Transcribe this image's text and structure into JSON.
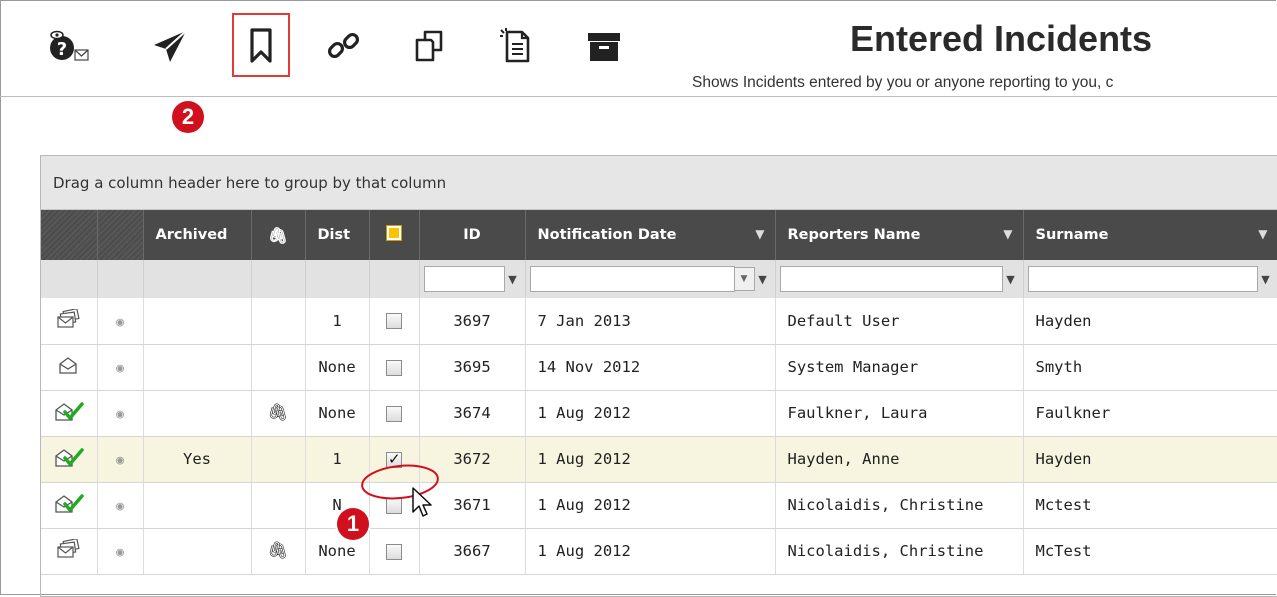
{
  "toolbar": {
    "icons": [
      "help-mail-icon",
      "send-icon",
      "bookmark-icon",
      "link-icon",
      "copy-icon",
      "new-document-icon",
      "archive-icon"
    ]
  },
  "page": {
    "title": "Entered Incidents",
    "subtitle": "Shows Incidents entered by you or anyone reporting to you, c"
  },
  "annotations": {
    "badge1": "1",
    "badge2": "2"
  },
  "grid": {
    "group_hint": "Drag a column header here to group by that column",
    "columns": [
      "",
      "",
      "Archived",
      "",
      "Dist",
      "",
      "ID",
      "Notification Date",
      "Reporters Name",
      "Surname"
    ],
    "rows": [
      {
        "status": "envelope-stack-icon",
        "archived": "",
        "attachment": false,
        "dist": "1",
        "checked": false,
        "id": "3697",
        "date": "7 Jan 2013",
        "reporter": "Default User",
        "surname": "Hayden"
      },
      {
        "status": "envelope-icon",
        "archived": "",
        "attachment": false,
        "dist": "None",
        "checked": false,
        "id": "3695",
        "date": "14 Nov 2012",
        "reporter": "System Manager",
        "surname": "Smyth"
      },
      {
        "status": "envelope-check-icon",
        "archived": "",
        "attachment": true,
        "dist": "None",
        "checked": false,
        "id": "3674",
        "date": "1 Aug 2012",
        "reporter": "Faulkner, Laura",
        "surname": "Faulkner"
      },
      {
        "status": "envelope-check-icon",
        "archived": "Yes",
        "attachment": false,
        "dist": "1",
        "checked": true,
        "id": "3672",
        "date": "1 Aug 2012",
        "reporter": "Hayden, Anne",
        "surname": "Hayden"
      },
      {
        "status": "envelope-check-icon",
        "archived": "",
        "attachment": false,
        "dist": "N",
        "checked": false,
        "id": "3671",
        "date": "1 Aug 2012",
        "reporter": "Nicolaidis, Christine",
        "surname": "Mctest"
      },
      {
        "status": "envelope-stack-icon",
        "archived": "",
        "attachment": true,
        "dist": "None",
        "checked": false,
        "id": "3667",
        "date": "1 Aug 2012",
        "reporter": "Nicolaidis, Christine",
        "surname": "McTest"
      }
    ]
  },
  "colors": {
    "highlight": "#e53935",
    "badge": "#d0101c",
    "header_bg": "#4a4a4a",
    "link": "#2f4fd6",
    "selected_row": "#f7f4e0",
    "check_green": "#22aa22"
  }
}
